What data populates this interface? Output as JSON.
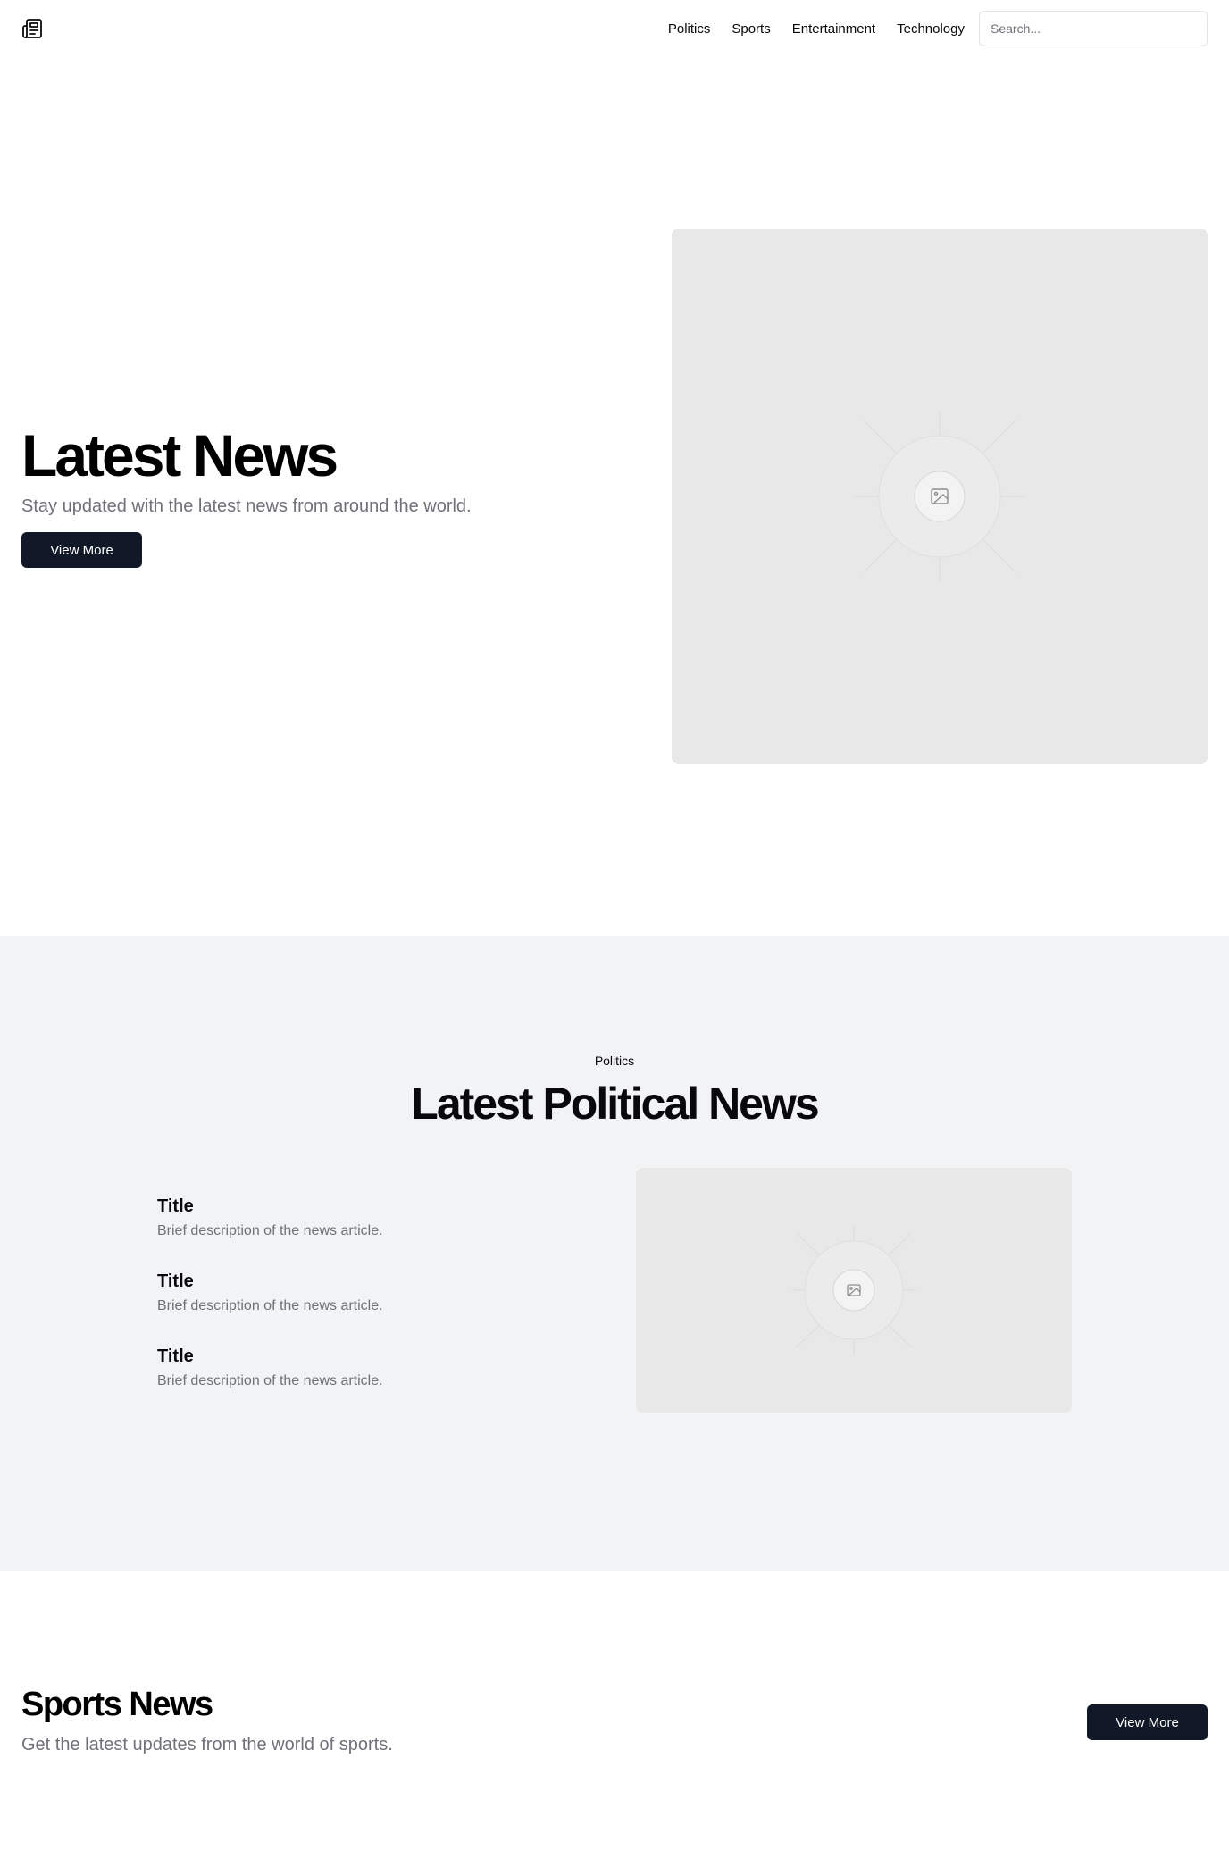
{
  "header": {
    "logo_icon": "newspaper-icon",
    "nav": [
      {
        "label": "Politics"
      },
      {
        "label": "Sports"
      },
      {
        "label": "Entertainment"
      },
      {
        "label": "Technology"
      }
    ],
    "search": {
      "placeholder": "Search...",
      "value": ""
    }
  },
  "hero": {
    "title": "Latest News",
    "subtitle": "Stay updated with the latest news from around the world.",
    "button_label": "View More",
    "image_icon": "image-placeholder-icon"
  },
  "politics": {
    "eyebrow": "Politics",
    "title": "Latest Political News",
    "articles": [
      {
        "title": "Title",
        "description": "Brief description of the news article."
      },
      {
        "title": "Title",
        "description": "Brief description of the news article."
      },
      {
        "title": "Title",
        "description": "Brief description of the news article."
      }
    ],
    "image_icon": "image-placeholder-icon"
  },
  "sports": {
    "title": "Sports News",
    "subtitle": "Get the latest updates from the world of sports.",
    "button_label": "View More"
  },
  "colors": {
    "primary_button": "#111827",
    "muted_text": "#71717a",
    "section_background": "#f2f3f5",
    "placeholder_background": "#e8e8e8"
  }
}
